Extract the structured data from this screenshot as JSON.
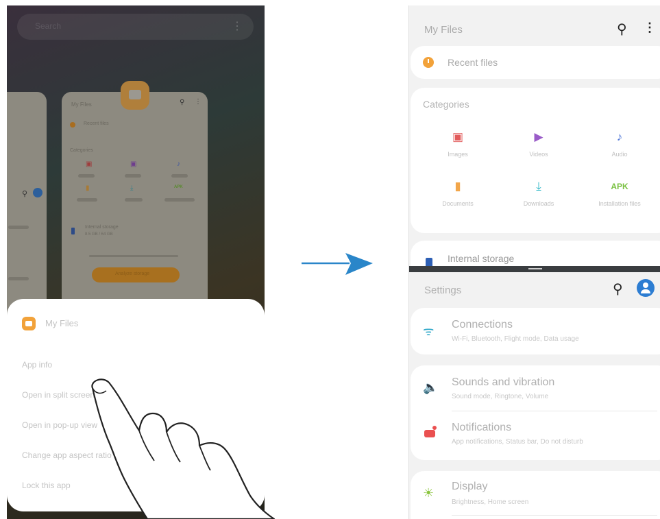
{
  "colors": {
    "orange": "#f2a23a",
    "blue_accent": "#2d7dd2",
    "arrow": "#2a86c9",
    "images": "#e25b5b",
    "videos": "#9a5cc8",
    "audio": "#5077d8",
    "docs": "#f2a64a",
    "downloads": "#2fb7c7",
    "apk": "#7ac142",
    "wifi": "#2fa8c9",
    "sound": "#6b6fd6",
    "notif": "#ea5050",
    "display": "#8bc53f"
  },
  "left": {
    "search_placeholder": "Search",
    "mini_card": {
      "title": "My Files",
      "recent": "Recent files",
      "categories": "Categories",
      "cats": [
        "Images",
        "Videos",
        "Audio",
        "Documents",
        "Downloads",
        "Installation files"
      ],
      "storage_title": "Internal storage",
      "storage_sub": "8.5 GB / 64 GB",
      "analyze": "Analyze storage"
    },
    "popup": {
      "app_name": "My Files",
      "items": [
        "App info",
        "Open in split screen view",
        "Open in pop-up view",
        "Change app aspect ratio",
        "Lock this app"
      ]
    }
  },
  "right": {
    "files": {
      "title": "My Files",
      "recent": "Recent files",
      "categories_title": "Categories",
      "categories": [
        {
          "label": "Images",
          "icon": "image-icon",
          "glyph": "🖼"
        },
        {
          "label": "Videos",
          "icon": "video-icon",
          "glyph": "▶"
        },
        {
          "label": "Audio",
          "icon": "music-note-icon",
          "glyph": "♪"
        },
        {
          "label": "Documents",
          "icon": "document-icon",
          "glyph": "▮"
        },
        {
          "label": "Downloads",
          "icon": "download-icon",
          "glyph": "⤓"
        },
        {
          "label": "Installation files",
          "icon": "apk-icon",
          "glyph": "APK"
        }
      ],
      "storage": "Internal storage"
    },
    "settings": {
      "title": "Settings",
      "items": [
        {
          "title": "Connections",
          "sub": "Wi-Fi, Bluetooth, Flight mode, Data usage",
          "icon": "wifi-icon"
        },
        {
          "title": "Sounds and vibration",
          "sub": "Sound mode, Ringtone, Volume",
          "icon": "speaker-icon"
        },
        {
          "title": "Notifications",
          "sub": "App notifications, Status bar, Do not disturb",
          "icon": "notification-icon"
        },
        {
          "title": "Display",
          "sub": "Brightness, Home screen",
          "icon": "sun-icon"
        }
      ]
    }
  }
}
